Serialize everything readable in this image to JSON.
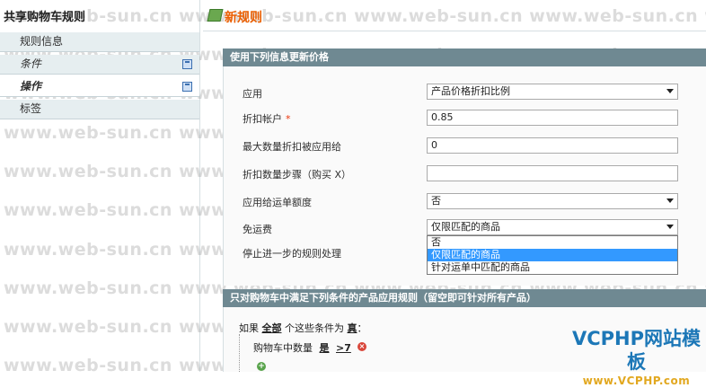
{
  "sidebar": {
    "title": "共享购物车规则",
    "tabs": [
      {
        "label": "规则信息"
      },
      {
        "label": "条件"
      },
      {
        "label": "操作"
      },
      {
        "label": "标签"
      }
    ]
  },
  "main": {
    "page_title": "新规则",
    "actions_section": {
      "title": "使用下列信息更新价格",
      "apply_label": "应用",
      "apply_value": "产品价格折扣比例",
      "discount_amount_label": "折扣帐户",
      "discount_amount_value": "0.85",
      "max_qty_label": "最大数量折扣被应用给",
      "max_qty_value": "0",
      "discount_step_label": "折扣数量步骤（购买 X）",
      "discount_step_value": "",
      "apply_shipping_label": "应用给运单额度",
      "apply_shipping_value": "否",
      "free_shipping_label": "免运费",
      "free_shipping_value": "仅限匹配的商品",
      "free_shipping_options": [
        "否",
        "仅限匹配的商品",
        "针对运单中匹配的商品"
      ],
      "stop_rules_label": "停止进一步的规则处理"
    },
    "conditions_section": {
      "title": "只对购物车中满足下列条件的产品应用规则（留空即可针对所有产品）",
      "if_text": "如果",
      "all_text": "全部",
      "mid_text": "个这些条件为",
      "true_text": "真",
      "colon": "：",
      "condition_label": "购物车中数量",
      "condition_op": "是",
      "condition_value": ">7"
    }
  },
  "watermark": {
    "text": "www.web-sun.cn"
  },
  "brand": {
    "main": "VCPHP网站模板",
    "sub": "www.VCPHP.com"
  }
}
